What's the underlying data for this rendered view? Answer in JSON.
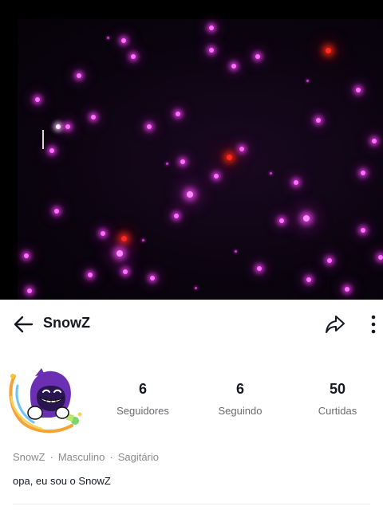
{
  "header": {
    "username": "SnowZ",
    "back_icon": "arrow-left-icon",
    "share_icon": "share-icon",
    "more_icon": "more-vertical-icon"
  },
  "profile": {
    "avatar_icon": "cartoon-avatar-icon",
    "stats": [
      {
        "value": "6",
        "label": "Seguidores"
      },
      {
        "value": "6",
        "label": "Seguindo"
      },
      {
        "value": "50",
        "label": "Curtidas"
      }
    ],
    "meta": [
      "SnowZ",
      "Masculino",
      "Sagitário"
    ],
    "meta_separator": "·",
    "bio": "opa, eu sou o SnowZ"
  },
  "colors": {
    "text_primary": "#161823",
    "text_secondary": "#8a8b91",
    "star_pink": "#ff6cff",
    "star_red": "#ff2a1a",
    "cover_background": "#000000"
  }
}
